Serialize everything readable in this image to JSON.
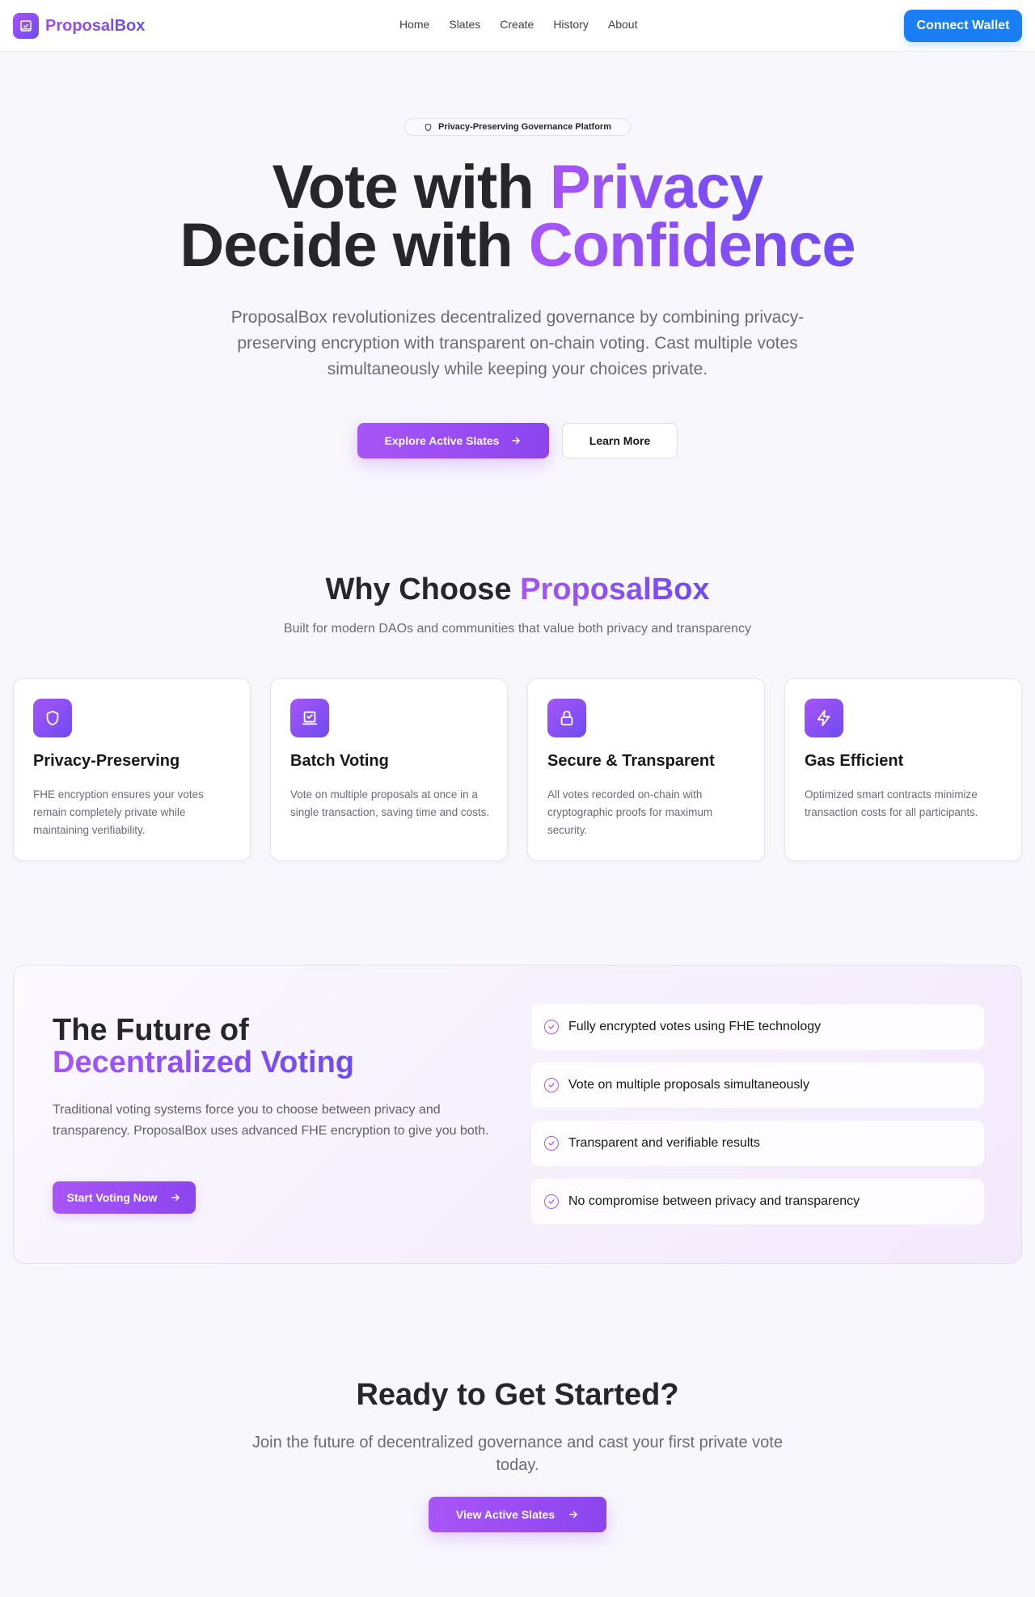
{
  "nav": {
    "brand": "ProposalBox",
    "links": [
      "Home",
      "Slates",
      "Create",
      "History",
      "About"
    ],
    "connect": "Connect Wallet"
  },
  "hero": {
    "badge": "Privacy-Preserving Governance Platform",
    "line1_a": "Vote with ",
    "line1_b": "Privacy",
    "line2_a": "Decide with ",
    "line2_b": "Confidence",
    "subtitle": "ProposalBox revolutionizes decentralized governance by combining privacy-preserving encryption with transparent on-chain voting. Cast multiple votes simultaneously while keeping your choices private.",
    "primary_cta": "Explore Active Slates",
    "secondary_cta": "Learn More"
  },
  "why": {
    "title_a": "Why Choose ",
    "title_b": "ProposalBox",
    "subtitle": "Built for modern DAOs and communities that value both privacy and transparency",
    "features": [
      {
        "icon": "shield-icon",
        "title": "Privacy-Preserving",
        "desc": "FHE encryption ensures your votes remain completely private while maintaining verifiability."
      },
      {
        "icon": "ballot-box-icon",
        "title": "Batch Voting",
        "desc": "Vote on multiple proposals at once in a single transaction, saving time and costs."
      },
      {
        "icon": "lock-icon",
        "title": "Secure & Transparent",
        "desc": "All votes recorded on-chain with cryptographic proofs for maximum security."
      },
      {
        "icon": "lightning-icon",
        "title": "Gas Efficient",
        "desc": "Optimized smart contracts minimize transaction costs for all participants."
      }
    ]
  },
  "future": {
    "title_a": "The Future of",
    "title_b": "Decentralized Voting",
    "text": "Traditional voting systems force you to choose between privacy and transparency. ProposalBox uses advanced FHE encryption to give you both.",
    "cta": "Start Voting Now",
    "checks": [
      "Fully encrypted votes using FHE technology",
      "Vote on multiple proposals simultaneously",
      "Transparent and verifiable results",
      "No compromise between privacy and transparency"
    ]
  },
  "ready": {
    "title": "Ready to Get Started?",
    "subtitle": "Join the future of decentralized governance and cast your first private vote today.",
    "cta": "View Active Slates"
  },
  "colors": {
    "accent": "#a855f7",
    "accent_dark": "#6d4bf0",
    "connect_blue": "#1a7ef5",
    "background": "#f8f7fc"
  }
}
